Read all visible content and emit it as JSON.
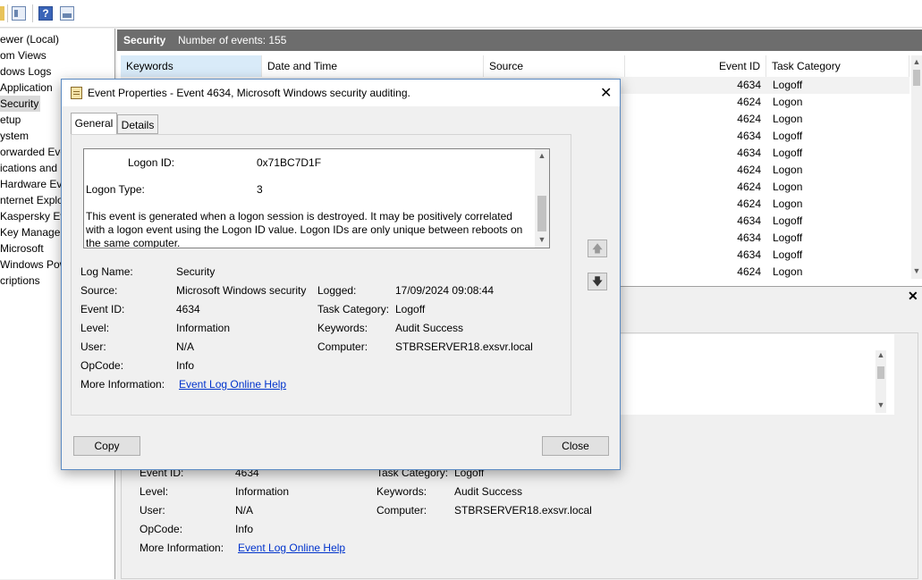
{
  "toolbar": {
    "icons": [
      "folder-icon",
      "panel-icon",
      "help-icon",
      "preview-pane-icon"
    ]
  },
  "tree": {
    "items": [
      {
        "label": "ewer (Local)"
      },
      {
        "label": "om Views"
      },
      {
        "label": "dows Logs"
      },
      {
        "label": "Application"
      },
      {
        "label": "Security"
      },
      {
        "label": "etup"
      },
      {
        "label": "ystem"
      },
      {
        "label": "orwarded Eve"
      },
      {
        "label": "ications and"
      },
      {
        "label": "Hardware Eve"
      },
      {
        "label": "nternet Explo"
      },
      {
        "label": "Kaspersky Eve"
      },
      {
        "label": "Key Managem"
      },
      {
        "label": "Microsoft"
      },
      {
        "label": "Windows Pow"
      },
      {
        "label": "criptions"
      }
    ]
  },
  "log_header": {
    "name": "Security",
    "count_label": "Number of events: 155"
  },
  "grid": {
    "columns": [
      "Keywords",
      "Date and Time",
      "Source",
      "Event ID",
      "Task Category"
    ],
    "rows": [
      {
        "event_id": "4634",
        "category": "Logoff"
      },
      {
        "event_id": "4624",
        "category": "Logon"
      },
      {
        "event_id": "4624",
        "category": "Logon"
      },
      {
        "event_id": "4634",
        "category": "Logoff"
      },
      {
        "event_id": "4634",
        "category": "Logoff"
      },
      {
        "event_id": "4624",
        "category": "Logon"
      },
      {
        "event_id": "4624",
        "category": "Logon"
      },
      {
        "event_id": "4624",
        "category": "Logon"
      },
      {
        "event_id": "4634",
        "category": "Logoff"
      },
      {
        "event_id": "4634",
        "category": "Logoff"
      },
      {
        "event_id": "4634",
        "category": "Logoff"
      },
      {
        "event_id": "4624",
        "category": "Logon"
      }
    ]
  },
  "lower": {
    "event_id_label": "Event ID:",
    "event_id": "4634",
    "task_category_label": "Task Category:",
    "task_category": "Logoff",
    "level_label": "Level:",
    "level": "Information",
    "keywords_label": "Keywords:",
    "keywords": "Audit Success",
    "user_label": "User:",
    "user": "N/A",
    "computer_label": "Computer:",
    "computer": "STBRSERVER18.exsvr.local",
    "opcode_label": "OpCode:",
    "opcode": "Info",
    "more_info_label": "More Information:",
    "more_info_link": "Event Log Online Help"
  },
  "dialog": {
    "title": "Event Properties - Event 4634, Microsoft Windows security auditing.",
    "tabs": [
      "General",
      "Details"
    ],
    "desc": {
      "logon_id_label": "Logon ID:",
      "logon_id": "0x71BC7D1F",
      "logon_type_label": "Logon Type:",
      "logon_type": "3",
      "text": "This event is generated when a logon session is destroyed. It may be positively correlated with a logon event using the Logon ID value. Logon IDs are only unique between reboots on the same computer."
    },
    "fields": {
      "log_name_label": "Log Name:",
      "log_name": "Security",
      "source_label": "Source:",
      "source": "Microsoft Windows security",
      "logged_label": "Logged:",
      "logged": "17/09/2024 09:08:44",
      "event_id_label": "Event ID:",
      "event_id": "4634",
      "task_category_label": "Task Category:",
      "task_category": "Logoff",
      "level_label": "Level:",
      "level": "Information",
      "keywords_label": "Keywords:",
      "keywords": "Audit Success",
      "user_label": "User:",
      "user": "N/A",
      "computer_label": "Computer:",
      "computer": "STBRSERVER18.exsvr.local",
      "opcode_label": "OpCode:",
      "opcode": "Info",
      "more_info_label": "More Information:",
      "more_info_link": "Event Log Online Help"
    },
    "buttons": {
      "copy": "Copy",
      "close": "Close"
    }
  }
}
